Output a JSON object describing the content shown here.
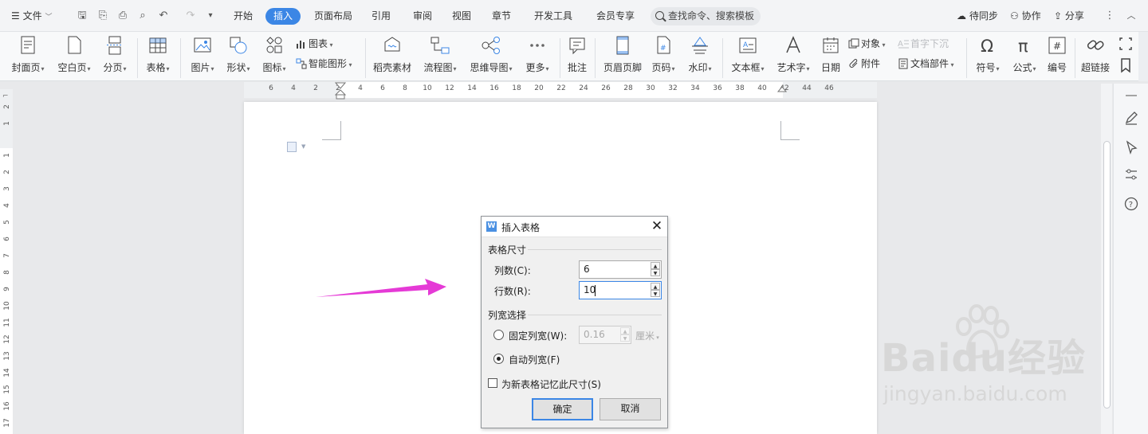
{
  "menubar": {
    "file_label": "文件",
    "tabs": [
      {
        "label": "开始",
        "active": false
      },
      {
        "label": "插入",
        "active": true
      },
      {
        "label": "页面布局",
        "active": false
      },
      {
        "label": "引用",
        "active": false
      },
      {
        "label": "审阅",
        "active": false
      },
      {
        "label": "视图",
        "active": false
      },
      {
        "label": "章节",
        "active": false
      },
      {
        "label": "开发工具",
        "active": false
      },
      {
        "label": "会员专享",
        "active": false
      }
    ],
    "search_text": "查找命令、搜索模板",
    "sync_label": "待同步",
    "collab_label": "协作",
    "share_label": "分享"
  },
  "ribbon": {
    "cover": "封面页",
    "blank": "空白页",
    "pagebreak": "分页",
    "table": "表格",
    "picture": "图片",
    "shape": "形状",
    "icon": "图标",
    "chart": "图表",
    "smartart": "智能图形",
    "material": "稻壳素材",
    "flowchart": "流程图",
    "mindmap": "思维导图",
    "more": "更多",
    "comment": "批注",
    "header_footer": "页眉页脚",
    "page_number": "页码",
    "watermark": "水印",
    "textbox": "文本框",
    "wordart": "艺术字",
    "date": "日期",
    "object": "对象",
    "dropcap": "首字下沉",
    "attachment": "附件",
    "doc_parts": "文档部件",
    "symbol": "符号",
    "formula": "公式",
    "numbering": "编号",
    "hyperlink": "超链接"
  },
  "ruler": {
    "h_ticks": [
      "6",
      "4",
      "2",
      "2",
      "4",
      "6",
      "8",
      "10",
      "12",
      "14",
      "16",
      "18",
      "20",
      "22",
      "24",
      "26",
      "28",
      "30",
      "32",
      "34",
      "36",
      "38",
      "40",
      "42",
      "44",
      "46"
    ],
    "v_ticks_top": [
      "2",
      "1"
    ],
    "v_ticks": [
      "1",
      "2",
      "3",
      "4",
      "5",
      "6",
      "7",
      "8",
      "9",
      "10",
      "11",
      "12",
      "13",
      "14",
      "15",
      "16",
      "17"
    ]
  },
  "dialog": {
    "title": "插入表格",
    "size_group": "表格尺寸",
    "cols_label": "列数(C):",
    "cols_value": "6",
    "rows_label": "行数(R):",
    "rows_value": "10",
    "width_group": "列宽选择",
    "fixed_label": "固定列宽(W):",
    "fixed_value": "0.16",
    "fixed_unit": "厘米",
    "auto_label": "自动列宽(F)",
    "remember_label": "为新表格记忆此尺寸(S)",
    "ok_label": "确定",
    "cancel_label": "取消",
    "selected_width_mode": "auto",
    "remember_checked": false
  },
  "watermark": {
    "brand": "Baidu经验",
    "url": "jingyan.baidu.com"
  },
  "colors": {
    "accent": "#3b86e5",
    "arrow": "#e53ad6"
  }
}
